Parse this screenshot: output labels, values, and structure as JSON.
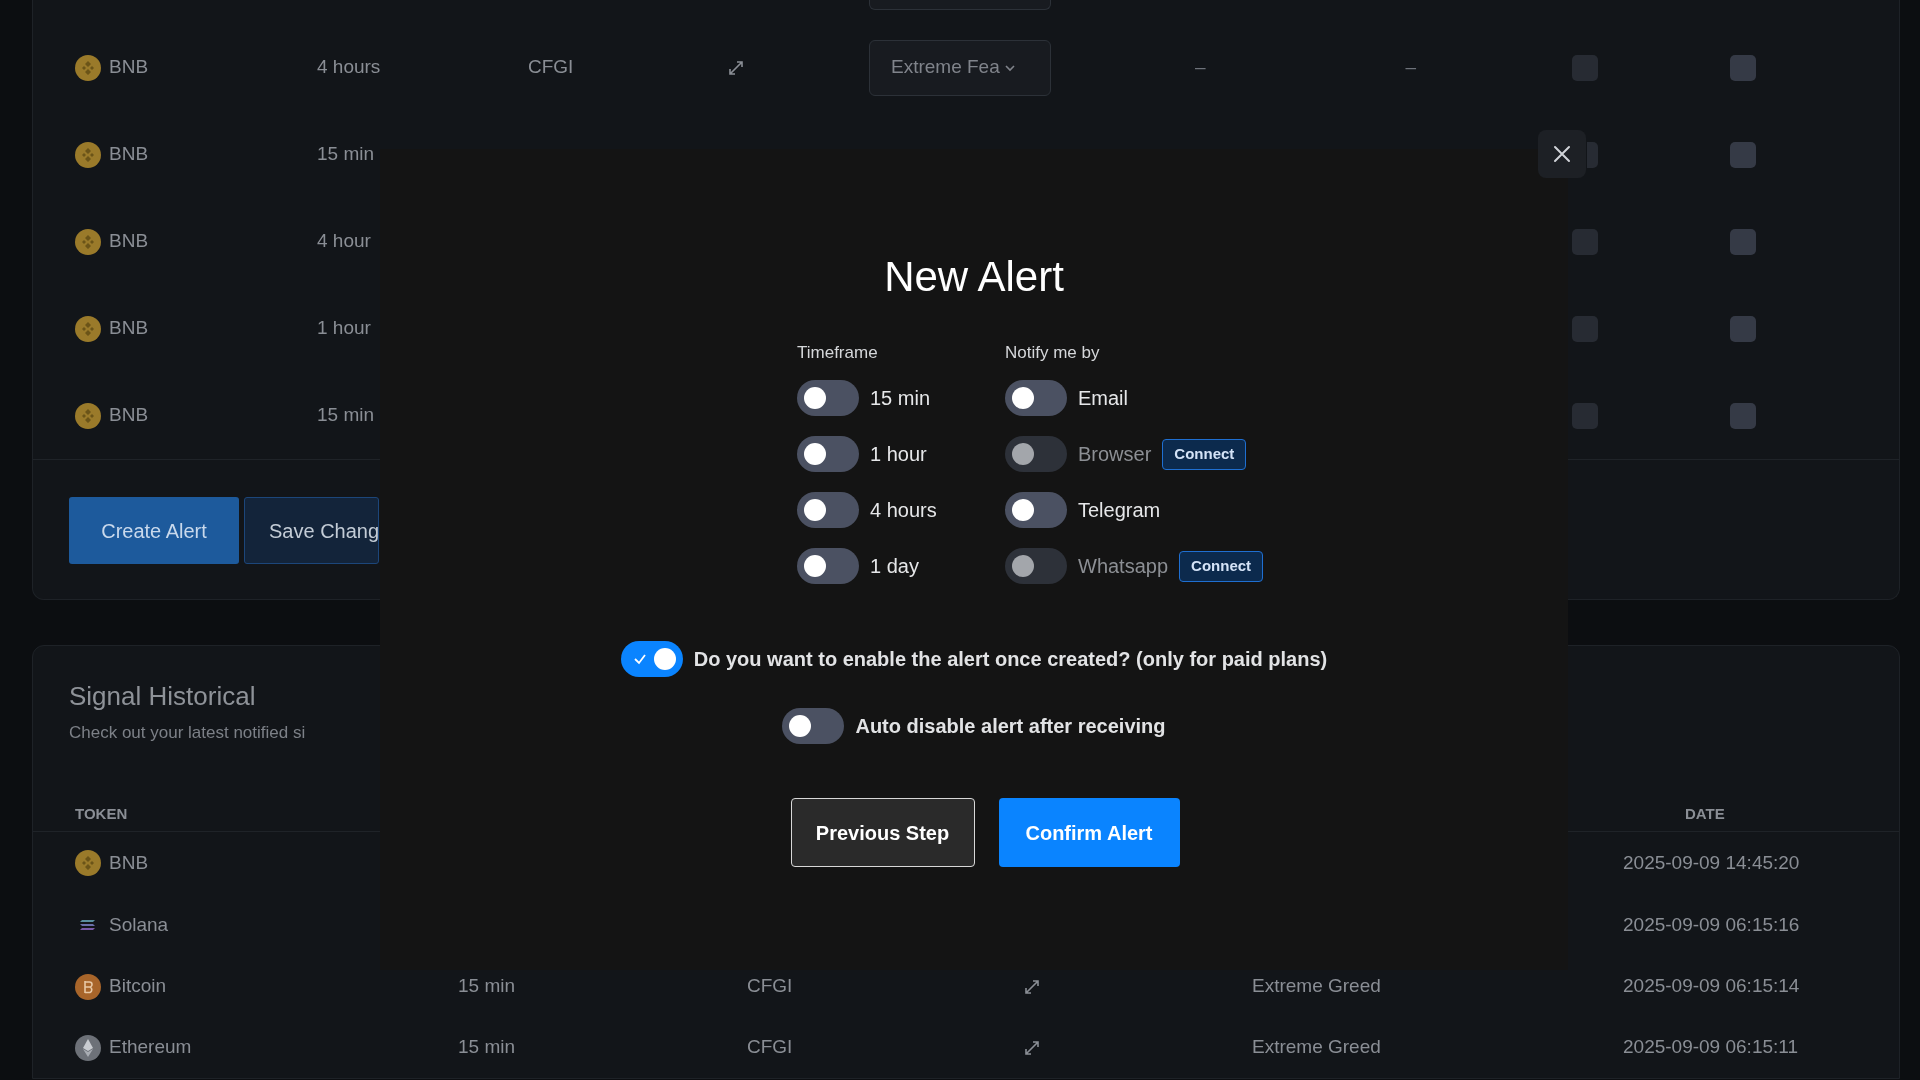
{
  "alerts_table": {
    "rows": [
      {
        "kind": "bnb",
        "token": "BNB",
        "timeframe": "4 hours",
        "indicator": "CFGI",
        "dropdown": "Extreme Fea",
        "column_6": "–",
        "column_7": "–",
        "checkbox_1": false,
        "checkbox_2": false
      },
      {
        "kind": "bnb",
        "token": "BNB",
        "timeframe": "15 min",
        "checkbox_1": false,
        "checkbox_2": false
      },
      {
        "kind": "bnb",
        "token": "BNB",
        "timeframe": "4 hour",
        "checkbox_1": false,
        "checkbox_2": false
      },
      {
        "kind": "bnb",
        "token": "BNB",
        "timeframe": "1 hour",
        "checkbox_1": false,
        "checkbox_2": false
      },
      {
        "kind": "bnb",
        "token": "BNB",
        "timeframe": "15 min",
        "checkbox_1": false,
        "checkbox_2": false
      }
    ],
    "buttons": [
      {
        "label": "Create Alert",
        "kind": "primary"
      },
      {
        "label": "Save Chang",
        "kind": "secondary"
      }
    ]
  },
  "signal_historical": {
    "title": "Signal Historical",
    "subtitle": "Check out your latest notified si",
    "columns": [
      "TOKEN",
      "DATE"
    ],
    "rows": [
      {
        "kind": "bnb",
        "token": "BNB",
        "date": "2025-09-09 14:45:20"
      },
      {
        "kind": "solana",
        "token": "Solana",
        "date": "2025-09-09 06:15:16"
      },
      {
        "kind": "bitcoin",
        "token": "Bitcoin",
        "timeframe": "15 min",
        "indicator": "CFGI",
        "signal": "Extreme Greed",
        "date": "2025-09-09 06:15:14"
      },
      {
        "kind": "ethereum",
        "token": "Ethereum",
        "timeframe": "15 min",
        "indicator": "CFGI",
        "signal": "Extreme Greed",
        "date": "2025-09-09 06:15:11"
      }
    ]
  },
  "modal": {
    "title": "New Alert",
    "timeframe_label": "Timeframe",
    "timeframes": [
      {
        "label": "15 min",
        "on": false
      },
      {
        "label": "1 hour",
        "on": false
      },
      {
        "label": "4 hours",
        "on": false
      },
      {
        "label": "1 day",
        "on": false
      }
    ],
    "notify_label": "Notify me by",
    "channels": [
      {
        "label": "Email",
        "on": false,
        "disabled": false
      },
      {
        "label": "Browser",
        "on": false,
        "disabled": true,
        "connect": "Connect"
      },
      {
        "label": "Telegram",
        "on": false,
        "disabled": false
      },
      {
        "label": "Whatsapp",
        "on": false,
        "disabled": true,
        "connect": "Connect"
      }
    ],
    "options": [
      {
        "label": "Do you want to enable the alert once created? (only for paid plans)",
        "on": true
      },
      {
        "label": "Auto disable alert after receiving",
        "on": false
      }
    ],
    "buttons": [
      {
        "label": "Previous Step",
        "kind": "secondary"
      },
      {
        "label": "Confirm Alert",
        "kind": "primary"
      }
    ]
  }
}
